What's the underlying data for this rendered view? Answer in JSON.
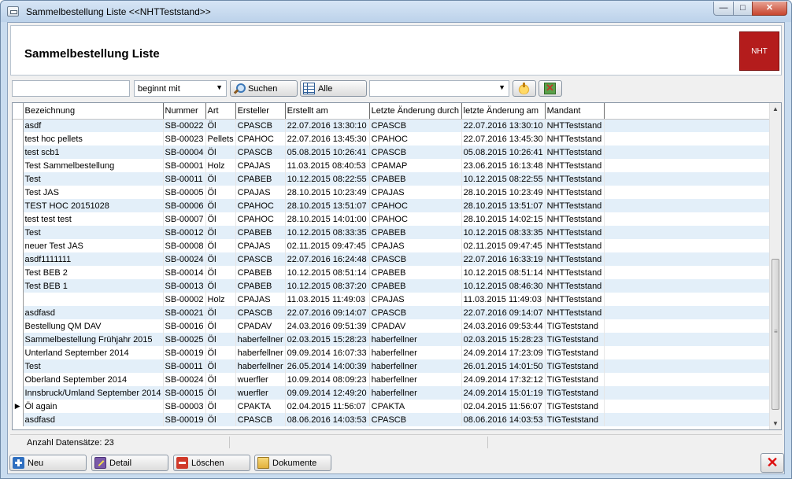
{
  "window": {
    "title": "Sammelbestellung Liste   <<NHTTeststand>>",
    "minimize": "—",
    "maximize": "□",
    "close": "✕"
  },
  "header": {
    "title": "Sammelbestellung Liste",
    "logo_text": "NHT",
    "logo_color": "#b41c1c"
  },
  "toolbar": {
    "search_value": "",
    "match_mode": "beginnt mit",
    "search_label": "Suchen",
    "all_label": "Alle",
    "filter_value": ""
  },
  "table": {
    "columns": [
      "Bezeichnung",
      "Nummer",
      "Art",
      "Ersteller",
      "Erstellt am",
      "Letzte Änderung durch",
      "letzte Änderung am",
      "Mandant"
    ],
    "current_row_marker": "▶",
    "rows": [
      [
        "asdf",
        "SB-00022",
        "Öl",
        "CPASCB",
        "22.07.2016 13:30:10",
        "CPASCB",
        "22.07.2016 13:30:10",
        "NHTTeststand"
      ],
      [
        "test hoc pellets",
        "SB-00023",
        "Pellets",
        "CPAHOC",
        "22.07.2016 13:45:30",
        "CPAHOC",
        "22.07.2016 13:45:30",
        "NHTTeststand"
      ],
      [
        "test scb1",
        "SB-00004",
        "Öl",
        "CPASCB",
        "05.08.2015 10:26:41",
        "CPASCB",
        "05.08.2015 10:26:41",
        "NHTTeststand"
      ],
      [
        "Test Sammelbestellung",
        "SB-00001",
        "Holz",
        "CPAJAS",
        "11.03.2015 08:40:53",
        "CPAMAP",
        "23.06.2015 16:13:48",
        "NHTTeststand"
      ],
      [
        "Test",
        "SB-00011",
        "Öl",
        "CPABEB",
        "10.12.2015 08:22:55",
        "CPABEB",
        "10.12.2015 08:22:55",
        "NHTTeststand"
      ],
      [
        "Test JAS",
        "SB-00005",
        "Öl",
        "CPAJAS",
        "28.10.2015 10:23:49",
        "CPAJAS",
        "28.10.2015 10:23:49",
        "NHTTeststand"
      ],
      [
        "TEST HOC 20151028",
        "SB-00006",
        "Öl",
        "CPAHOC",
        "28.10.2015 13:51:07",
        "CPAHOC",
        "28.10.2015 13:51:07",
        "NHTTeststand"
      ],
      [
        "test test test",
        "SB-00007",
        "Öl",
        "CPAHOC",
        "28.10.2015 14:01:00",
        "CPAHOC",
        "28.10.2015 14:02:15",
        "NHTTeststand"
      ],
      [
        "Test",
        "SB-00012",
        "Öl",
        "CPABEB",
        "10.12.2015 08:33:35",
        "CPABEB",
        "10.12.2015 08:33:35",
        "NHTTeststand"
      ],
      [
        "neuer Test JAS",
        "SB-00008",
        "Öl",
        "CPAJAS",
        "02.11.2015 09:47:45",
        "CPAJAS",
        "02.11.2015 09:47:45",
        "NHTTeststand"
      ],
      [
        "asdf1111111",
        "SB-00024",
        "Öl",
        "CPASCB",
        "22.07.2016 16:24:48",
        "CPASCB",
        "22.07.2016 16:33:19",
        "NHTTeststand"
      ],
      [
        "Test BEB 2",
        "SB-00014",
        "Öl",
        "CPABEB",
        "10.12.2015 08:51:14",
        "CPABEB",
        "10.12.2015 08:51:14",
        "NHTTeststand"
      ],
      [
        "Test BEB 1",
        "SB-00013",
        "Öl",
        "CPABEB",
        "10.12.2015 08:37:20",
        "CPABEB",
        "10.12.2015 08:46:30",
        "NHTTeststand"
      ],
      [
        "",
        "SB-00002",
        "Holz",
        "CPAJAS",
        "11.03.2015 11:49:03",
        "CPAJAS",
        "11.03.2015 11:49:03",
        "NHTTeststand"
      ],
      [
        "asdfasd",
        "SB-00021",
        "Öl",
        "CPASCB",
        "22.07.2016 09:14:07",
        "CPASCB",
        "22.07.2016 09:14:07",
        "NHTTeststand"
      ],
      [
        "Bestellung QM DAV",
        "SB-00016",
        "Öl",
        "CPADAV",
        "24.03.2016 09:51:39",
        "CPADAV",
        "24.03.2016 09:53:44",
        "TIGTeststand"
      ],
      [
        "Sammelbestellung Frühjahr 2015",
        "SB-00025",
        "Öl",
        "haberfellner",
        "02.03.2015 15:28:23",
        "haberfellner",
        "02.03.2015 15:28:23",
        "TIGTeststand"
      ],
      [
        "Unterland September 2014",
        "SB-00019",
        "Öl",
        "haberfellner",
        "09.09.2014 16:07:33",
        "haberfellner",
        "24.09.2014 17:23:09",
        "TIGTeststand"
      ],
      [
        "Test",
        "SB-00011",
        "Öl",
        "haberfellner",
        "26.05.2014 14:00:39",
        "haberfellner",
        "26.01.2015 14:01:50",
        "TIGTeststand"
      ],
      [
        "Oberland September 2014",
        "SB-00024",
        "Öl",
        "wuerfler",
        "10.09.2014 08:09:23",
        "haberfellner",
        "24.09.2014 17:32:12",
        "TIGTeststand"
      ],
      [
        "Innsbruck/Umland September 2014",
        "SB-00015",
        "Öl",
        "wuerfler",
        "09.09.2014 12:49:20",
        "haberfellner",
        "24.09.2014 15:01:19",
        "TIGTeststand"
      ],
      [
        "Öl again",
        "SB-00003",
        "Öl",
        "CPAKTA",
        "02.04.2015 11:56:07",
        "CPAKTA",
        "02.04.2015 11:56:07",
        "TIGTeststand"
      ],
      [
        "asdfasd",
        "SB-00019",
        "Öl",
        "CPASCB",
        "08.06.2016 14:03:53",
        "CPASCB",
        "08.06.2016 14:03:53",
        "TIGTeststand"
      ]
    ],
    "current_row_index": 21
  },
  "status": {
    "record_count": "Anzahl Datensätze: 23"
  },
  "actions": {
    "new_label": "Neu",
    "detail_label": "Detail",
    "delete_label": "Löschen",
    "documents_label": "Dokumente",
    "close_label": "✕"
  }
}
